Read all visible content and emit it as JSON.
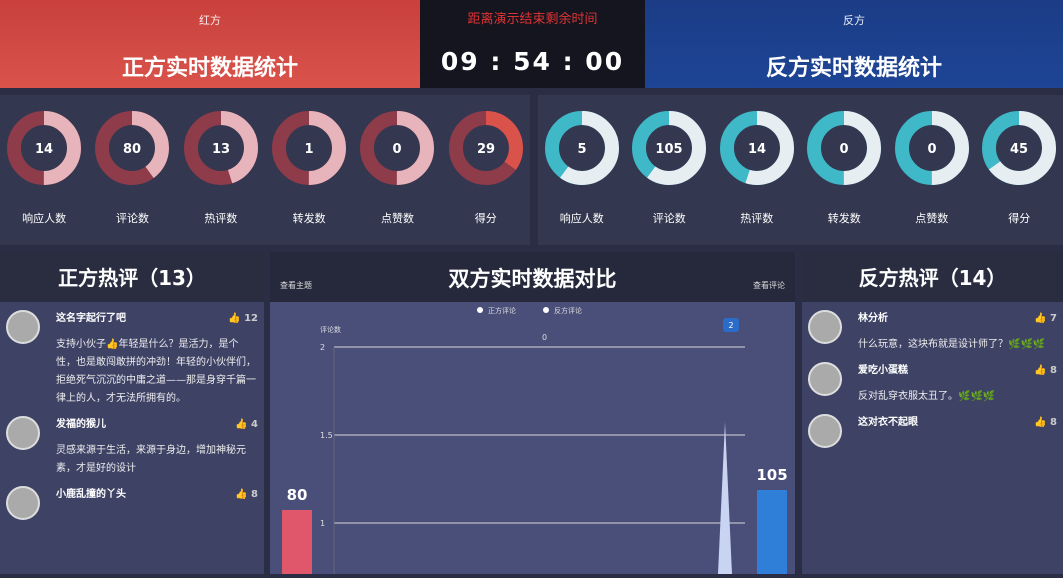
{
  "header": {
    "red_side": "红方",
    "red_title": "正方实时数据统计",
    "countdown_title": "距离演示结束剩余时间",
    "countdown": "09 : 54 : 00",
    "blue_side": "反方",
    "blue_title": "反方实时数据统计"
  },
  "red_stats": [
    {
      "label": "响应人数",
      "value": "14",
      "fraction": 0.5
    },
    {
      "label": "评论数",
      "value": "80",
      "fraction": 0.4
    },
    {
      "label": "热评数",
      "value": "13",
      "fraction": 0.45
    },
    {
      "label": "转发数",
      "value": "1",
      "fraction": 0.5
    },
    {
      "label": "点赞数",
      "value": "0",
      "fraction": 0.5
    },
    {
      "label": "得分",
      "value": "29",
      "fraction": 0.35
    }
  ],
  "blue_stats": [
    {
      "label": "响应人数",
      "value": "5",
      "fraction": 0.6
    },
    {
      "label": "评论数",
      "value": "105",
      "fraction": 0.6
    },
    {
      "label": "热评数",
      "value": "14",
      "fraction": 0.55
    },
    {
      "label": "转发数",
      "value": "0",
      "fraction": 0.5
    },
    {
      "label": "点赞数",
      "value": "0",
      "fraction": 0.5
    },
    {
      "label": "得分",
      "value": "45",
      "fraction": 0.65
    }
  ],
  "colors": {
    "red": "#d9534b",
    "red_ring": "#8e3b4a",
    "red_light": "#e8b4bc",
    "blue": "#3fb8c8",
    "blue_light": "#e6eef2"
  },
  "left_panel": {
    "title": "正方热评（13）",
    "comments": [
      {
        "name": "这名字起行了吧",
        "likes": "12",
        "text": "支持小伙子👍年轻是什么？是活力，是个性，也是敢闯敢拼的冲劲！年轻的小伙伴们，拒绝死气沉沉的中庸之道——那是身穿千篇一律上的人，才无法所拥有的。"
      },
      {
        "name": "发福的猴儿",
        "likes": "4",
        "text": "灵感来源于生活，来源于身边，增加神秘元素，才是好的设计"
      },
      {
        "name": "小鹿乱撞的丫头",
        "likes": "8",
        "text": ""
      }
    ]
  },
  "right_panel": {
    "title": "反方热评（14）",
    "comments": [
      {
        "name": "林分析",
        "likes": "7",
        "text": "什么玩意，这块布就是设计师了？🌿🌿🌿"
      },
      {
        "name": "爱吃小蛋糕",
        "likes": "8",
        "text": "反对乱穿衣服太丑了。🌿🌿🌿"
      },
      {
        "name": "这对衣不起眼",
        "likes": "8",
        "text": ""
      }
    ]
  },
  "chart_data": {
    "type": "line",
    "title": "双方实时数据对比",
    "left_link": "查看主题",
    "right_link": "查看评论",
    "legend": [
      "正方评论",
      "反方评论"
    ],
    "ylabel": "评论数",
    "yticks": [
      "2",
      "1.5",
      "1"
    ],
    "point_labels": [
      "0",
      "2"
    ],
    "bars": [
      {
        "label": "80",
        "value": 80,
        "color": "#e0566a"
      },
      {
        "label": "105",
        "value": 105,
        "color": "#2f7fd8"
      }
    ]
  }
}
